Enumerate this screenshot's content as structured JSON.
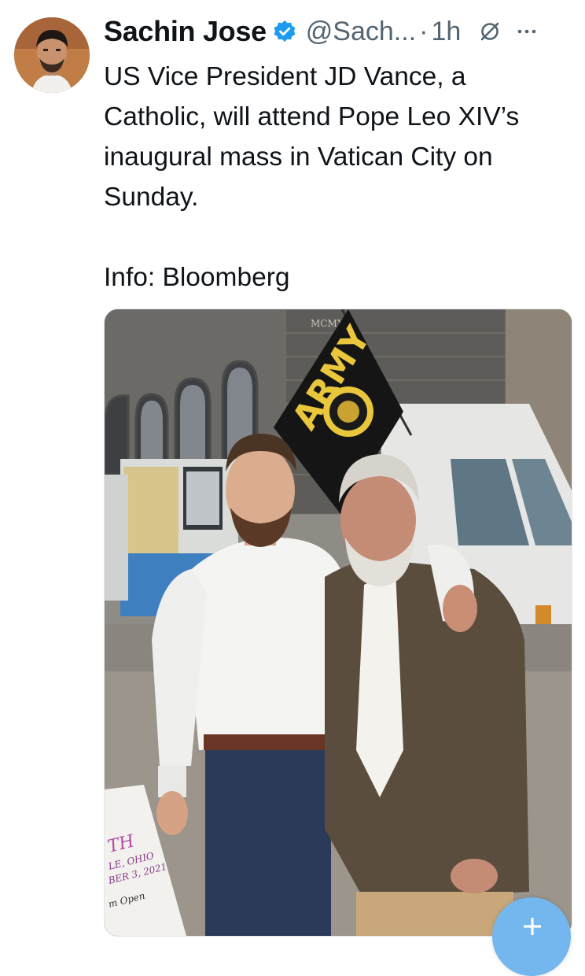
{
  "author": {
    "name": "Sachin Jose",
    "handle": "@Sach...",
    "separator": "·",
    "time": "1h"
  },
  "tweet": {
    "text": "US Vice President JD Vance, a Catholic, will attend Pope Leo XIV’s inaugural mass in Vatican City on Sunday.",
    "source": "Info: Bloomberg"
  },
  "media": {
    "flag_text": "ARMY",
    "building_inscription": "MCMXIX",
    "sign_text": [
      "TH",
      "LE, OHIO",
      "BER 3, 2021",
      "m Open"
    ]
  },
  "icons": {
    "verified": "verified-badge-icon",
    "grok": "grok-icon",
    "more": "more-dots-icon",
    "compose": "plus-icon"
  },
  "colors": {
    "accent": "#1d9bf0",
    "fab": "#73b7ee",
    "muted_text": "#536471"
  }
}
